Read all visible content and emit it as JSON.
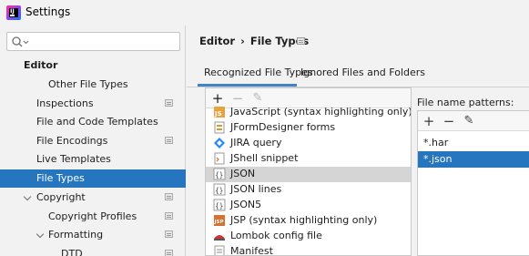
{
  "window": {
    "title": "Settings",
    "app_icon_letters": "IJ"
  },
  "search": {
    "placeholder": "",
    "value": ""
  },
  "sidebar": {
    "items": [
      {
        "label": "Editor"
      },
      {
        "label": "Other File Types"
      },
      {
        "label": "Inspections"
      },
      {
        "label": "File and Code Templates"
      },
      {
        "label": "File Encodings"
      },
      {
        "label": "Live Templates"
      },
      {
        "label": "File Types"
      },
      {
        "label": "Copyright"
      },
      {
        "label": "Copyright Profiles"
      },
      {
        "label": "Formatting"
      },
      {
        "label": "DTD"
      }
    ]
  },
  "breadcrumb": {
    "parent": "Editor",
    "separator": "›",
    "current": "File Types"
  },
  "tabs": [
    {
      "label": "Recognized File Types",
      "active": true
    },
    {
      "label": "Ignored Files and Folders",
      "active": false
    }
  ],
  "file_types": {
    "toolbar": {
      "add": "+",
      "remove": "−",
      "edit": "✎"
    },
    "items": [
      {
        "label": "JavaScript (syntax highlighting only)",
        "icon": "javascript-icon"
      },
      {
        "label": "JFormDesigner forms",
        "icon": "jformdesigner-icon"
      },
      {
        "label": "JIRA query",
        "icon": "jira-icon"
      },
      {
        "label": "JShell snippet",
        "icon": "jshell-icon"
      },
      {
        "label": "JSON",
        "icon": "json-icon",
        "selected": true
      },
      {
        "label": "JSON lines",
        "icon": "json-icon"
      },
      {
        "label": "JSON5",
        "icon": "json-icon"
      },
      {
        "label": "JSP (syntax highlighting only)",
        "icon": "jsp-icon"
      },
      {
        "label": "Lombok config file",
        "icon": "lombok-icon"
      },
      {
        "label": "Manifest",
        "icon": "manifest-icon"
      }
    ]
  },
  "patterns": {
    "label": "File name patterns:",
    "toolbar": {
      "add": "+",
      "remove": "−",
      "edit": "✎"
    },
    "items": [
      {
        "label": "*.har",
        "selected": false
      },
      {
        "label": "*.json",
        "selected": true
      }
    ]
  },
  "colors": {
    "selection": "#2675bf",
    "list_selection": "#d5d5d5",
    "tab_underline": "#4083c9"
  }
}
